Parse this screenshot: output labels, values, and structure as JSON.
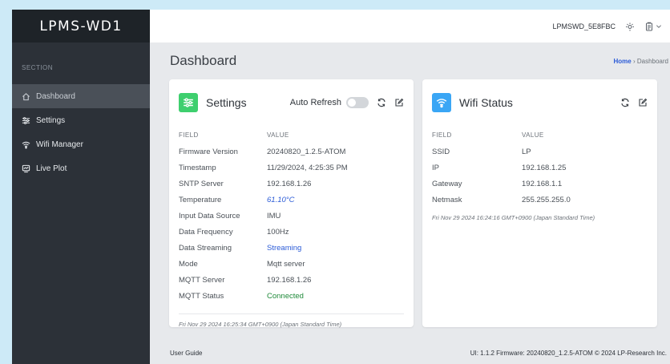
{
  "sidebar": {
    "brand": "LPMS-WD1",
    "section_label": "SECTION",
    "items": [
      {
        "label": "Dashboard",
        "icon": "home-icon"
      },
      {
        "label": "Settings",
        "icon": "sliders-icon"
      },
      {
        "label": "Wifi Manager",
        "icon": "wifi-icon"
      },
      {
        "label": "Live Plot",
        "icon": "chart-icon"
      }
    ]
  },
  "topbar": {
    "device_name": "LPMSWD_5E8FBC"
  },
  "page": {
    "title": "Dashboard",
    "breadcrumb_home": "Home",
    "breadcrumb_sep": "›",
    "breadcrumb_current": "Dashboard"
  },
  "settings_card": {
    "title": "Settings",
    "auto_refresh_label": "Auto Refresh",
    "auto_refresh_on": false,
    "col_field": "FIELD",
    "col_value": "VALUE",
    "rows": [
      {
        "field": "Firmware Version",
        "value": "20240820_1.2.5-ATOM"
      },
      {
        "field": "Timestamp",
        "value": "11/29/2024, 4:25:35 PM"
      },
      {
        "field": "SNTP Server",
        "value": "192.168.1.26"
      },
      {
        "field": "Temperature",
        "value": "61.10°C"
      },
      {
        "field": "Input Data Source",
        "value": "IMU"
      },
      {
        "field": "Data Frequency",
        "value": "100Hz"
      },
      {
        "field": "Data Streaming",
        "value": "Streaming"
      },
      {
        "field": "Mode",
        "value": "Mqtt server"
      },
      {
        "field": "MQTT Server",
        "value": "192.168.1.26"
      },
      {
        "field": "MQTT Status",
        "value": "Connected"
      }
    ],
    "footer_time": "Fri Nov 29 2024 16:25:34 GMT+0900 (Japan Standard Time)",
    "accent": "#3ecf6e"
  },
  "wifi_card": {
    "title": "Wifi Status",
    "col_field": "FIELD",
    "col_value": "VALUE",
    "rows": [
      {
        "field": "SSID",
        "value": "LP"
      },
      {
        "field": "IP",
        "value": "192.168.1.25"
      },
      {
        "field": "Gateway",
        "value": "192.168.1.1"
      },
      {
        "field": "Netmask",
        "value": "255.255.255.0"
      }
    ],
    "footer_time": "Fri Nov 29 2024 16:24:16 GMT+0900 (Japan Standard Time)",
    "accent": "#3aa6f5"
  },
  "footer": {
    "user_guide": "User Guide",
    "version_info": "UI: 1.1.2  Firmware: 20240820_1.2.5-ATOM  © 2024 LP-Research Inc."
  }
}
